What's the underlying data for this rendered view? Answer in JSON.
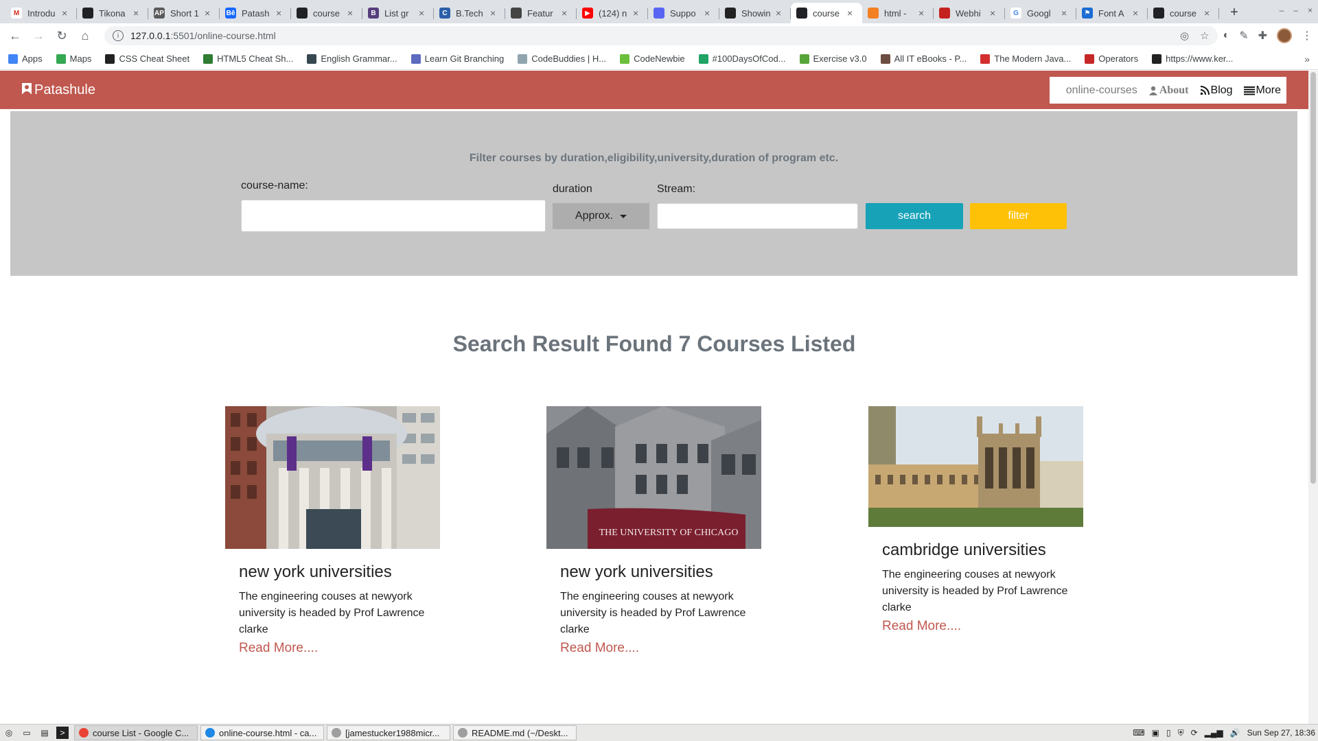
{
  "browser": {
    "tabs": [
      {
        "title": "Introdu",
        "fav_color": "#ffffff",
        "fav_glyph": "M",
        "fav_text": "#d93025"
      },
      {
        "title": "Tikona",
        "fav_color": "#202124",
        "fav_glyph": "",
        "fav_text": "#fff"
      },
      {
        "title": "Short 1",
        "fav_color": "#5a5a5a",
        "fav_glyph": "AP",
        "fav_text": "#fff"
      },
      {
        "title": "Patash",
        "fav_color": "#1769ff",
        "fav_glyph": "Bē",
        "fav_text": "#fff"
      },
      {
        "title": "course",
        "fav_color": "#202124",
        "fav_glyph": "",
        "fav_text": "#fff"
      },
      {
        "title": "List gr",
        "fav_color": "#563d7c",
        "fav_glyph": "B",
        "fav_text": "#fff"
      },
      {
        "title": "B.Tech",
        "fav_color": "#2a5ea8",
        "fav_glyph": "C",
        "fav_text": "#fff"
      },
      {
        "title": "Featur",
        "fav_color": "#444",
        "fav_glyph": "",
        "fav_text": "#fff"
      },
      {
        "title": "(124) n",
        "fav_color": "#ff0000",
        "fav_glyph": "▶",
        "fav_text": "#fff"
      },
      {
        "title": "Suppo",
        "fav_color": "#5865f2",
        "fav_glyph": "",
        "fav_text": "#fff"
      },
      {
        "title": "Showin",
        "fav_color": "#222",
        "fav_glyph": "",
        "fav_text": "#fff"
      },
      {
        "title": "course",
        "fav_color": "#202124",
        "fav_glyph": "",
        "fav_text": "#fff",
        "active": true
      },
      {
        "title": "html -",
        "fav_color": "#f48024",
        "fav_glyph": "",
        "fav_text": "#fff"
      },
      {
        "title": "Webhi",
        "fav_color": "#c5221f",
        "fav_glyph": "",
        "fav_text": "#fff"
      },
      {
        "title": "Googl",
        "fav_color": "#ffffff",
        "fav_glyph": "G",
        "fav_text": "#4285f4"
      },
      {
        "title": "Font A",
        "fav_color": "#1c6cd4",
        "fav_glyph": "⚑",
        "fav_text": "#fff"
      },
      {
        "title": "course",
        "fav_color": "#202124",
        "fav_glyph": "",
        "fav_text": "#fff"
      }
    ],
    "url_host": "127.0.0.1",
    "url_rest": ":5501/online-course.html",
    "bookmarks": [
      {
        "label": "Apps",
        "color": "#4285f4"
      },
      {
        "label": "Maps",
        "color": "#34a853"
      },
      {
        "label": "CSS Cheat Sheet",
        "color": "#222"
      },
      {
        "label": "HTML5 Cheat Sh...",
        "color": "#2e7d32"
      },
      {
        "label": "English Grammar...",
        "color": "#37474f"
      },
      {
        "label": "Learn Git Branching",
        "color": "#5c6bc0"
      },
      {
        "label": "CodeBuddies | H...",
        "color": "#90a4ae"
      },
      {
        "label": "CodeNewbie",
        "color": "#6bbf3b"
      },
      {
        "label": "#100DaysOfCod...",
        "color": "#21a366"
      },
      {
        "label": "Exercise v3.0",
        "color": "#57a639"
      },
      {
        "label": "All IT eBooks - P...",
        "color": "#6d4c41"
      },
      {
        "label": "The Modern Java...",
        "color": "#d32f2f"
      },
      {
        "label": "Operators",
        "color": "#c62828"
      },
      {
        "label": "https://www.ker...",
        "color": "#222"
      }
    ]
  },
  "site": {
    "brand": "Patashule",
    "nav": {
      "courses": "online-courses",
      "about": "About",
      "blog": "Blog",
      "more": "More"
    },
    "filter": {
      "title": "Filter courses by duration,eligibility,university,duration of program etc.",
      "course_name_label": "course-name:",
      "duration_label": "duration",
      "duration_value": "Approx.",
      "stream_label": "Stream:",
      "search_label": "search",
      "filter_label": "filter"
    },
    "result_title": "Search Result Found 7 Courses Listed",
    "cards": [
      {
        "title": "new york universities",
        "text": "The engineering couses at newyork university is headed by Prof Lawrence clarke",
        "link": "Read More...."
      },
      {
        "title": "new york universities",
        "text": "The engineering couses at newyork university is headed by Prof Lawrence clarke",
        "link": "Read More...."
      },
      {
        "title": "cambridge universities",
        "text": "The engineering couses at newyork university is headed by Prof Lawrence clarke",
        "link": "Read More...."
      }
    ],
    "chicago_sign": "THE UNIVERSITY OF CHICAGO"
  },
  "taskbar": {
    "tasks": [
      {
        "label": "course List - Google C...",
        "color": "#ea4335",
        "active": true
      },
      {
        "label": "online-course.html - ca...",
        "color": "#1e88e5"
      },
      {
        "label": "[jamestucker1988micr...",
        "color": "#9e9e9e"
      },
      {
        "label": "README.md (~/Deskt...",
        "color": "#9e9e9e"
      }
    ],
    "clock": "Sun Sep 27, 18:36"
  }
}
